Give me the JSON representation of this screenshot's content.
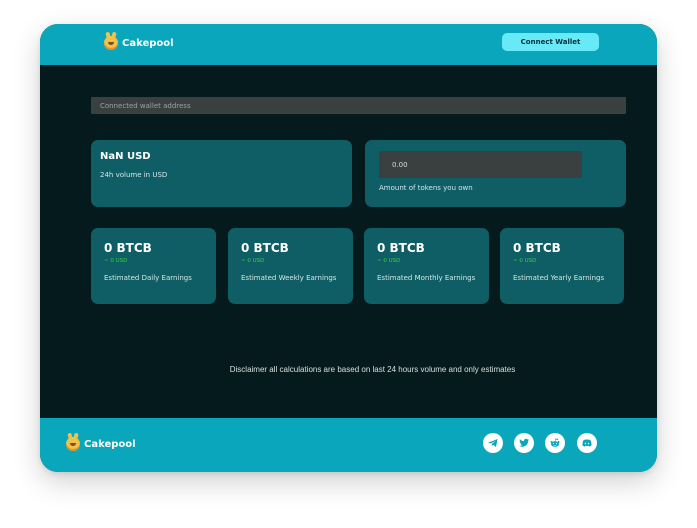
{
  "header": {
    "brand_name": "Cakepool",
    "connect_label": "Connect Wallet"
  },
  "wallet": {
    "placeholder": "Connected wallet address"
  },
  "volume": {
    "value": "NaN USD",
    "label": "24h volume in USD"
  },
  "tokens": {
    "value": "0.00",
    "label": "Amount of tokens you own"
  },
  "earnings": [
    {
      "value": "0 BTCB",
      "usd": "~ 0 USD",
      "label": "Estimated Daily Earnings"
    },
    {
      "value": "0 BTCB",
      "usd": "~ 0 USD",
      "label": "Estimated Weekly Earnings"
    },
    {
      "value": "0 BTCB",
      "usd": "~ 0 USD",
      "label": "Estimated Monthly Earnings"
    },
    {
      "value": "0 BTCB",
      "usd": "~ 0 USD",
      "label": "Estimated Yearly Earnings"
    }
  ],
  "disclaimer": "Disclaimer all calculations are based on last 24 hours volume and only estimates",
  "footer": {
    "brand_name": "Cakepool",
    "social_icons": [
      "telegram-icon",
      "twitter-icon",
      "reddit-icon",
      "discord-icon"
    ]
  },
  "colors": {
    "header_bg": "#0aa6bb",
    "page_bg": "#041a1c",
    "card_bg": "#0f5e66",
    "button_bg": "#67e9f7",
    "usd_green": "#34d43a"
  }
}
